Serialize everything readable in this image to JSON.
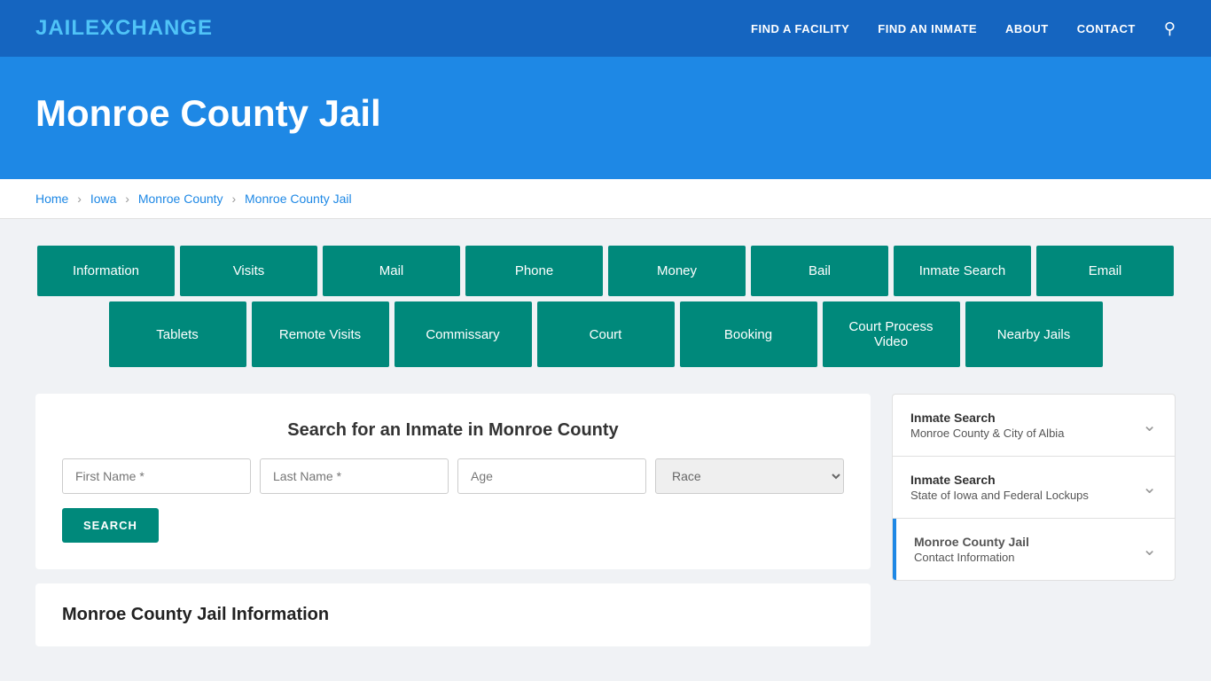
{
  "logo": {
    "part1": "JAIL",
    "part2": "E",
    "part3": "XCHANGE"
  },
  "nav": {
    "links": [
      {
        "label": "FIND A FACILITY",
        "id": "find-facility"
      },
      {
        "label": "FIND AN INMATE",
        "id": "find-inmate"
      },
      {
        "label": "ABOUT",
        "id": "about"
      },
      {
        "label": "CONTACT",
        "id": "contact"
      }
    ]
  },
  "hero": {
    "title": "Monroe County Jail"
  },
  "breadcrumb": {
    "items": [
      {
        "label": "Home",
        "href": "#"
      },
      {
        "label": "Iowa",
        "href": "#"
      },
      {
        "label": "Monroe County",
        "href": "#"
      },
      {
        "label": "Monroe County Jail",
        "href": "#"
      }
    ]
  },
  "grid_buttons": [
    "Information",
    "Visits",
    "Mail",
    "Phone",
    "Money",
    "Bail",
    "Inmate Search",
    "Email",
    "Tablets",
    "Remote Visits",
    "Commissary",
    "Court",
    "Booking",
    "Court Process Video",
    "Nearby Jails"
  ],
  "search": {
    "title": "Search for an Inmate in Monroe County",
    "first_name_placeholder": "First Name *",
    "last_name_placeholder": "Last Name *",
    "age_placeholder": "Age",
    "race_placeholder": "Race",
    "button_label": "SEARCH"
  },
  "info_section": {
    "title": "Monroe County Jail Information"
  },
  "sidebar": {
    "items": [
      {
        "title": "Inmate Search",
        "subtitle": "Monroe County & City of Albia",
        "active": false
      },
      {
        "title": "Inmate Search",
        "subtitle": "State of Iowa and Federal Lockups",
        "active": false
      },
      {
        "title": "Monroe County Jail",
        "subtitle": "Contact Information",
        "active": true
      }
    ]
  }
}
